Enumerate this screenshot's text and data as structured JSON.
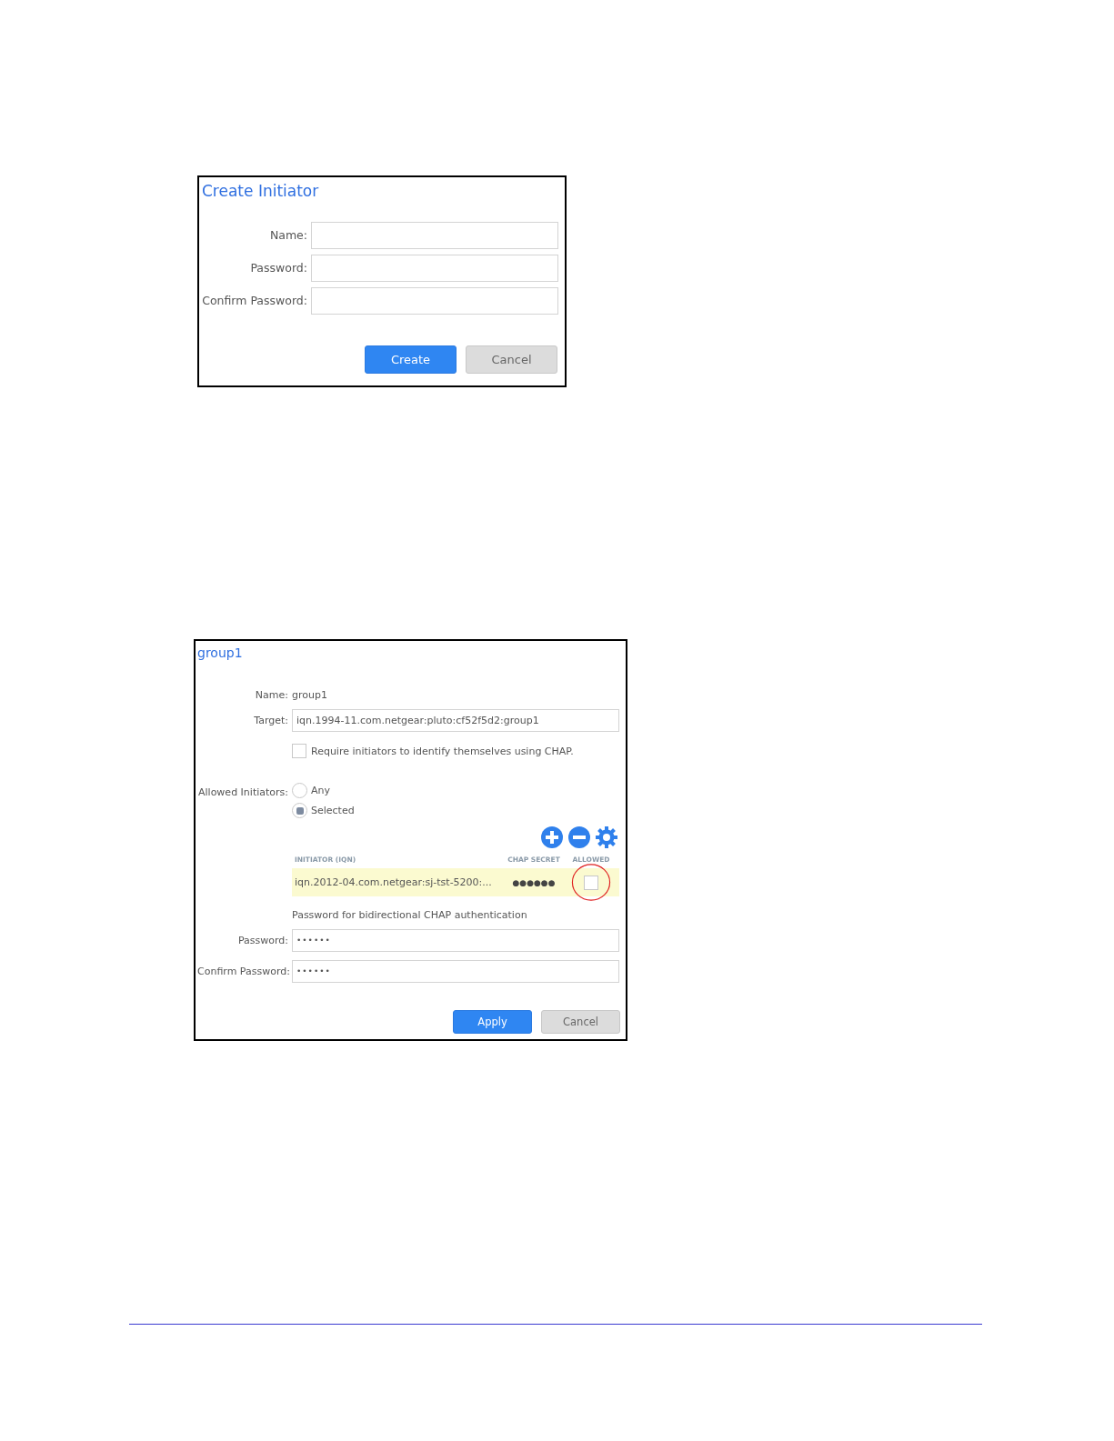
{
  "create_initiator": {
    "title": "Create Initiator",
    "fields": [
      {
        "label": "Name:"
      },
      {
        "label": "Password:"
      },
      {
        "label": "Confirm Password:"
      }
    ],
    "buttons": [
      {
        "label": "Create",
        "kind": "primary"
      },
      {
        "label": "Cancel",
        "kind": "secondary"
      }
    ]
  },
  "group_dialog": {
    "title": "group1",
    "name_label": "Name:",
    "name_value": "group1",
    "target_label": "Target:",
    "target_value": "iqn.1994-11.com.netgear:pluto:cf52f5d2:group1",
    "chap_required": {
      "label": "Require initiators to identify themselves using CHAP.",
      "checked": false
    },
    "allowed_label": "Allowed Initiators:",
    "allowed_options": [
      {
        "label": "Any",
        "selected": false
      },
      {
        "label": "Selected",
        "selected": true
      }
    ],
    "table": {
      "columns": [
        "INITIATOR (IQN)",
        "CHAP SECRET",
        "ALLOWED"
      ],
      "rows": [
        {
          "initiator": "iqn.2012-04.com.netgear:sj-tst-5200:...",
          "chap_secret": "●●●●●●",
          "allowed": false,
          "highlighted": true,
          "circled": true
        }
      ]
    },
    "bidir_caption": "Password for bidirectional CHAP authentication",
    "password_fields": [
      {
        "label": "Password:",
        "value": "••••••"
      },
      {
        "label": "Confirm Password:",
        "value": "••••••"
      }
    ],
    "buttons": [
      {
        "label": "Apply",
        "kind": "primary"
      },
      {
        "label": "Cancel",
        "kind": "secondary"
      }
    ]
  }
}
